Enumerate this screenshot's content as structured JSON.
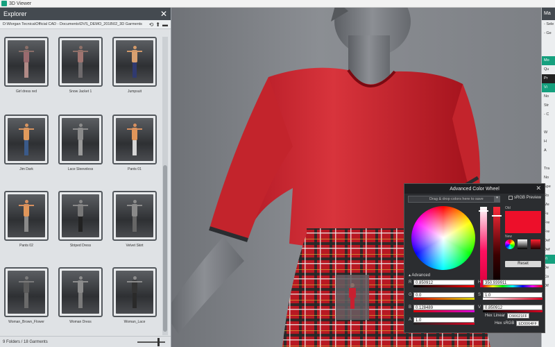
{
  "window": {
    "title": "3D Viewer"
  },
  "explorer": {
    "title": "Explorer",
    "close_glyph": "✕",
    "path": "D:\\Morgan Tecnica\\Official CAD - Documents\\DVS_DEMO_2018\\02_3D Garments",
    "tools": {
      "refresh": "⟲",
      "up": "⬆",
      "folder": "▬"
    },
    "items": [
      {
        "label": "Girl dress red",
        "body": "#9a6a6e",
        "legs": "#b08a86",
        "head": "#8a6e68"
      },
      {
        "label": "Snow Jacket 1",
        "body": "#a07470",
        "legs": "#6e6a6c",
        "head": "#8e7068"
      },
      {
        "label": "Jumpsuit",
        "body": "#d8a070",
        "legs": "#303a70",
        "head": "#d49a6a"
      },
      {
        "label": "Jim Dark",
        "body": "#e09a5c",
        "legs": "#3a5a8a",
        "head": "#d89460"
      },
      {
        "label": "Lace Sleeveless",
        "body": "#8a8a8a",
        "legs": "#9a9a9a",
        "head": "#8c8c8c"
      },
      {
        "label": "Pants 01",
        "body": "#e0965a",
        "legs": "#d6d6d6",
        "head": "#d89060"
      },
      {
        "label": "Pants 02",
        "body": "#e0965a",
        "legs": "#8a8a8a",
        "head": "#d89060"
      },
      {
        "label": "Striped Dress",
        "body": "#777777",
        "legs": "#222222",
        "head": "#888888"
      },
      {
        "label": "Velvet Skirt",
        "body": "#8a8a8a",
        "legs": "#666666",
        "head": "#8c8c8c"
      },
      {
        "label": "Woman_Brown_Flower",
        "body": "#5a5a5a",
        "legs": "#6a6a6a",
        "head": "#7a7a7a"
      },
      {
        "label": "Woman Dress",
        "body": "#8a8a8a",
        "legs": "#7a7a7a",
        "head": "#8c8c8c"
      },
      {
        "label": "Woman_Lace",
        "body": "#333333",
        "legs": "#2a2a2a",
        "head": "#8c8c8c"
      }
    ],
    "status": "9 Folders / 18 Garments"
  },
  "right_panel": {
    "rows": [
      "Ma",
      "- Sele",
      "- Ge",
      "",
      "",
      "Mo",
      "Qu",
      "Pr",
      "Vi",
      "No",
      "Str",
      "- C",
      "",
      "W",
      "H",
      "A",
      "",
      "Tra",
      "No",
      "Spe",
      "Ro",
      "Me",
      "Fu",
      "Fre",
      "Fre",
      "Def",
      "Def",
      "Vi",
      "De",
      "Co",
      "Dif"
    ]
  },
  "color_wheel": {
    "title": "Advanced Color Wheel",
    "close_glyph": "✕",
    "drop_hint": "Drag & drop colors here to save",
    "srgb_preview_label": "sRGB Preview",
    "old_label": "Old",
    "new_label": "New",
    "reset_label": "Reset",
    "advanced_label": "Advanced",
    "advanced_arrow": "▴",
    "old_color": "#ED0F2A",
    "fields_left": [
      {
        "label": "R",
        "value": "0.850912"
      },
      {
        "label": "G",
        "value": "0.0"
      },
      {
        "label": "B",
        "value": "0.128489"
      },
      {
        "label": "A",
        "value": "1.0"
      }
    ],
    "fields_right": [
      {
        "label": "H",
        "value": "350.939911"
      },
      {
        "label": "S",
        "value": "1.0"
      },
      {
        "label": "V",
        "value": "0.850912"
      }
    ],
    "hex_linear_label": "Hex Linear",
    "hex_linear_value": "D90021FF",
    "hex_srgb_label": "Hex sRGB",
    "hex_srgb_value": "ED0064FF"
  }
}
